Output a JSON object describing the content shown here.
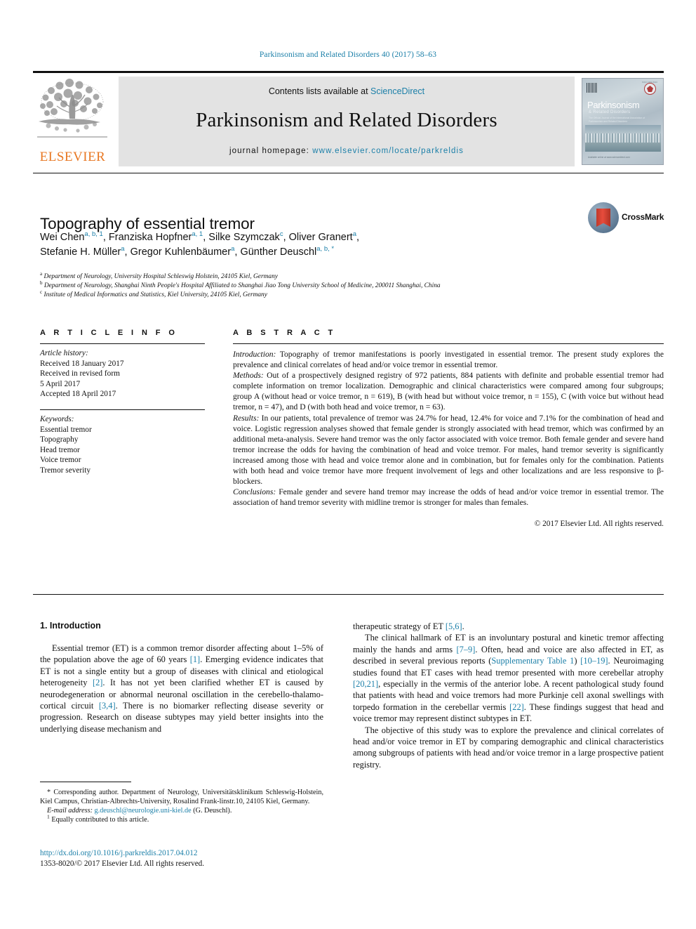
{
  "running_head": "Parkinsonism and Related Disorders 40 (2017) 58–63",
  "masthead": {
    "publisher_logo_label": "ELSEVIER",
    "contents_prefix": "Contents lists available at ",
    "contents_link": "ScienceDirect",
    "journal_title": "Parkinsonism and Related Disorders",
    "homepage_prefix": "journal homepage: ",
    "homepage_url": "www.elsevier.com/locate/parkreldis",
    "cover": {
      "title": "Parkinsonism",
      "subtitle": "& Related Disorders",
      "blurb": "The Official Journal of the International Association of Parkinsonism and Related Disorders",
      "topline": "ISSN 1353-8020",
      "footline": "Available online at www.sciencedirect.com"
    }
  },
  "article": {
    "title": "Topography of essential tremor",
    "authors_line_1": "Wei Chen",
    "authors": [
      {
        "name": "Wei Chen",
        "marks": "a, b, 1"
      },
      {
        "name": "Franziska Hopfner",
        "marks": "a, 1"
      },
      {
        "name": "Silke Szymczak",
        "marks": "c"
      },
      {
        "name": "Oliver Granert",
        "marks": "a"
      },
      {
        "name": "Stefanie H. Müller",
        "marks": "a"
      },
      {
        "name": "Gregor Kuhlenbäumer",
        "marks": "a"
      },
      {
        "name": "Günther Deuschl",
        "marks": "a, b, *"
      }
    ],
    "affiliations": [
      {
        "mark": "a",
        "text": "Department of Neurology, University Hospital Schleswig Holstein, 24105 Kiel, Germany"
      },
      {
        "mark": "b",
        "text": "Department of Neurology, Shanghai Ninth People's Hospital Affiliated to Shanghai Jiao Tong University School of Medicine, 200011 Shanghai, China"
      },
      {
        "mark": "c",
        "text": "Institute of Medical Informatics and Statistics, Kiel University, 24105 Kiel, Germany"
      }
    ],
    "crossmark_label": "CrossMark"
  },
  "article_info": {
    "heading": "A R T I C L E  I N F O",
    "history_label": "Article history:",
    "history": [
      "Received 18 January 2017",
      "Received in revised form",
      "5 April 2017",
      "Accepted 18 April 2017"
    ],
    "keywords_label": "Keywords:",
    "keywords": [
      "Essential tremor",
      "Topography",
      "Head tremor",
      "Voice tremor",
      "Tremor severity"
    ]
  },
  "abstract": {
    "heading": "A B S T R A C T",
    "sections": [
      {
        "label": "Introduction:",
        "text": " Topography of tremor manifestations is poorly investigated in essential tremor. The present study explores the prevalence and clinical correlates of head and/or voice tremor in essential tremor."
      },
      {
        "label": "Methods:",
        "text": " Out of a prospectively designed registry of 972 patients, 884 patients with definite and probable essential tremor had complete information on tremor localization. Demographic and clinical characteristics were compared among four subgroups; group A (without head or voice tremor, n = 619), B (with head but without voice tremor, n = 155), C (with voice but without head tremor, n = 47), and D (with both head and voice tremor, n = 63)."
      },
      {
        "label": "Results:",
        "text": " In our patients, total prevalence of tremor was 24.7% for head, 12.4% for voice and 7.1% for the combination of head and voice. Logistic regression analyses showed that female gender is strongly associated with head tremor, which was confirmed by an additional meta-analysis. Severe hand tremor was the only factor associated with voice tremor. Both female gender and severe hand tremor increase the odds for having the combination of head and voice tremor. For males, hand tremor severity is significantly increased among those with head and voice tremor alone and in combination, but for females only for the combination. Patients with both head and voice tremor have more frequent involvement of legs and other localizations and are less responsive to β-blockers."
      },
      {
        "label": "Conclusions:",
        "text": " Female gender and severe hand tremor may increase the odds of head and/or voice tremor in essential tremor. The association of hand tremor severity with midline tremor is stronger for males than females."
      }
    ],
    "copyright": "© 2017 Elsevier Ltd. All rights reserved."
  },
  "body": {
    "section_heading": "1. Introduction",
    "left_paragraphs": [
      "Essential tremor (ET) is a common tremor disorder affecting about 1–5% of the population above the age of 60 years [1]. Emerging evidence indicates that ET is not a single entity but a group of diseases with clinical and etiological heterogeneity [2]. It has not yet been clarified whether ET is caused by neurodegeneration or abnormal neuronal oscillation in the cerebello-thalamo-cortical circuit [3,4]. There is no biomarker reflecting disease severity or progression. Research on disease subtypes may yield better insights into the underlying disease mechanism and"
    ],
    "right_paragraphs": [
      "therapeutic strategy of ET [5,6].",
      "The clinical hallmark of ET is an involuntary postural and kinetic tremor affecting mainly the hands and arms [7–9]. Often, head and voice are also affected in ET, as described in several previous reports (Supplementary Table 1) [10–19]. Neuroimaging studies found that ET cases with head tremor presented with more cerebellar atrophy [20,21], especially in the vermis of the anterior lobe. A recent pathological study found that patients with head and voice tremors had more Purkinje cell axonal swellings with torpedo formation in the cerebellar vermis [22]. These findings suggest that head and voice tremor may represent distinct subtypes in ET.",
      "The objective of this study was to explore the prevalence and clinical correlates of head and/or voice tremor in ET by comparing demographic and clinical characteristics among subgroups of patients with head and/or voice tremor in a large prospective patient registry."
    ],
    "references_inline": [
      "[1]",
      "[2]",
      "[3,4]",
      "[5,6]",
      "[7–9]",
      "(Supplementary Table 1)",
      "[10–19]",
      "[20,21]",
      "[22]"
    ]
  },
  "footnotes": {
    "corresponding": "* Corresponding author. Department of Neurology, Universitätsklinikum Schleswig-Holstein, Kiel Campus, Christian-Albrechts-University, Rosalind Frank-linstr.10, 24105 Kiel, Germany.",
    "email_label": "E-mail address:",
    "email": "g.deuschl@neurologie.uni-kiel.de",
    "email_suffix": " (G. Deuschl).",
    "equal_contrib_mark": "1",
    "equal_contrib": " Equally contributed to this article."
  },
  "footer": {
    "doi": "http://dx.doi.org/10.1016/j.parkreldis.2017.04.012",
    "issn_line": "1353-8020/© 2017 Elsevier Ltd. All rights reserved."
  },
  "colors": {
    "link": "#1b7fa8",
    "elsevier_orange": "#e87722",
    "band_gray": "#e3e3e3"
  }
}
